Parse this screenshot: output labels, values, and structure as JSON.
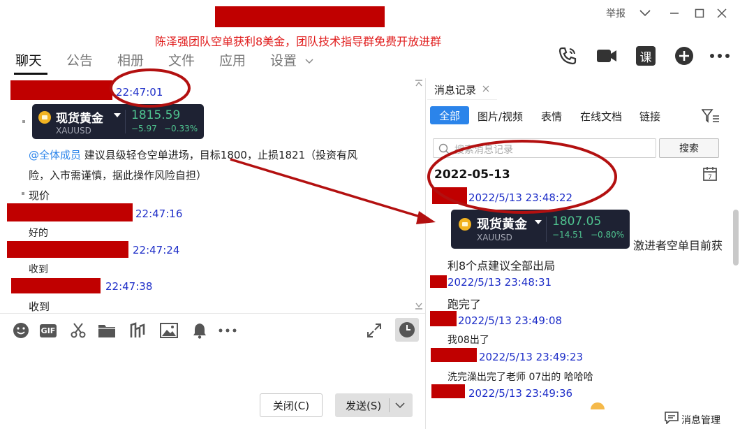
{
  "window": {
    "report_label": "举报",
    "banner": "陈泽强团队空单获利8美金，团队技术指导群免费开放进群"
  },
  "tabs": [
    "聊天",
    "公告",
    "相册",
    "文件",
    "应用",
    "设置"
  ],
  "toolbar_icons": [
    "phone-icon",
    "video-icon",
    "course-icon",
    "add-icon",
    "more-icon"
  ],
  "course_label": "课",
  "chat": {
    "messages": [
      {
        "time": "22:47:01"
      },
      {
        "time": "22:47:16",
        "text": "好的"
      },
      {
        "time": "22:47:24",
        "text": "收到"
      },
      {
        "time": "22:47:38",
        "text": "收到"
      }
    ],
    "gold_card": {
      "name": "现货黄金",
      "symbol": "XAUUSD",
      "price": "1815.59",
      "change": "−5.97",
      "change_pct": "−0.33%"
    },
    "mention": "@全体成员",
    "announcement_line1": " 建议县级轻仓空单进场，目标1800，止损1821（投资有风",
    "announcement_line2": "险，入市需谨慎，据此操作风险自担）",
    "current_price_label": "现价"
  },
  "input_toolbar": {
    "icons": [
      "emoji-icon",
      "gif-icon",
      "scissors-icon",
      "folder-icon",
      "shake-icon",
      "image-icon",
      "bell-icon",
      "more-icon",
      "expand-icon",
      "history-clock-icon"
    ],
    "gif_label": "GIF",
    "close_label": "关闭(C)",
    "send_label": "发送(S)"
  },
  "history": {
    "tab_label": "消息记录",
    "filters": [
      "全部",
      "图片/视频",
      "表情",
      "在线文档",
      "链接"
    ],
    "search_placeholder": "搜索消息记录",
    "search_button": "搜索",
    "date": "2022-05-13",
    "calendar_day": "7",
    "gold_card": {
      "name": "现货黄金",
      "symbol": "XAUUSD",
      "price": "1807.05",
      "change": "−14.51",
      "change_pct": "−0.80%"
    },
    "messages": [
      {
        "time": "2022/5/13 23:48:22",
        "text_a": "激进者空单目前获",
        "text_b": "利8个点建议全部出局"
      },
      {
        "time": "2022/5/13 23:48:31",
        "text": "跑完了"
      },
      {
        "time": "2022/5/13 23:49:08",
        "text": "我08出了"
      },
      {
        "time": "2022/5/13 23:49:23",
        "text": "洗完澡出完了老师 07出的 哈哈哈"
      },
      {
        "time": "2022/5/13 23:49:36"
      }
    ],
    "manage_label": "消息管理"
  },
  "colors": {
    "annotation_red": "#b31010",
    "timestamp_blue": "#1e2ec8",
    "accent_blue": "#2b84ea",
    "gain_green": "#4fc490",
    "banner_red": "#e01b1b"
  }
}
